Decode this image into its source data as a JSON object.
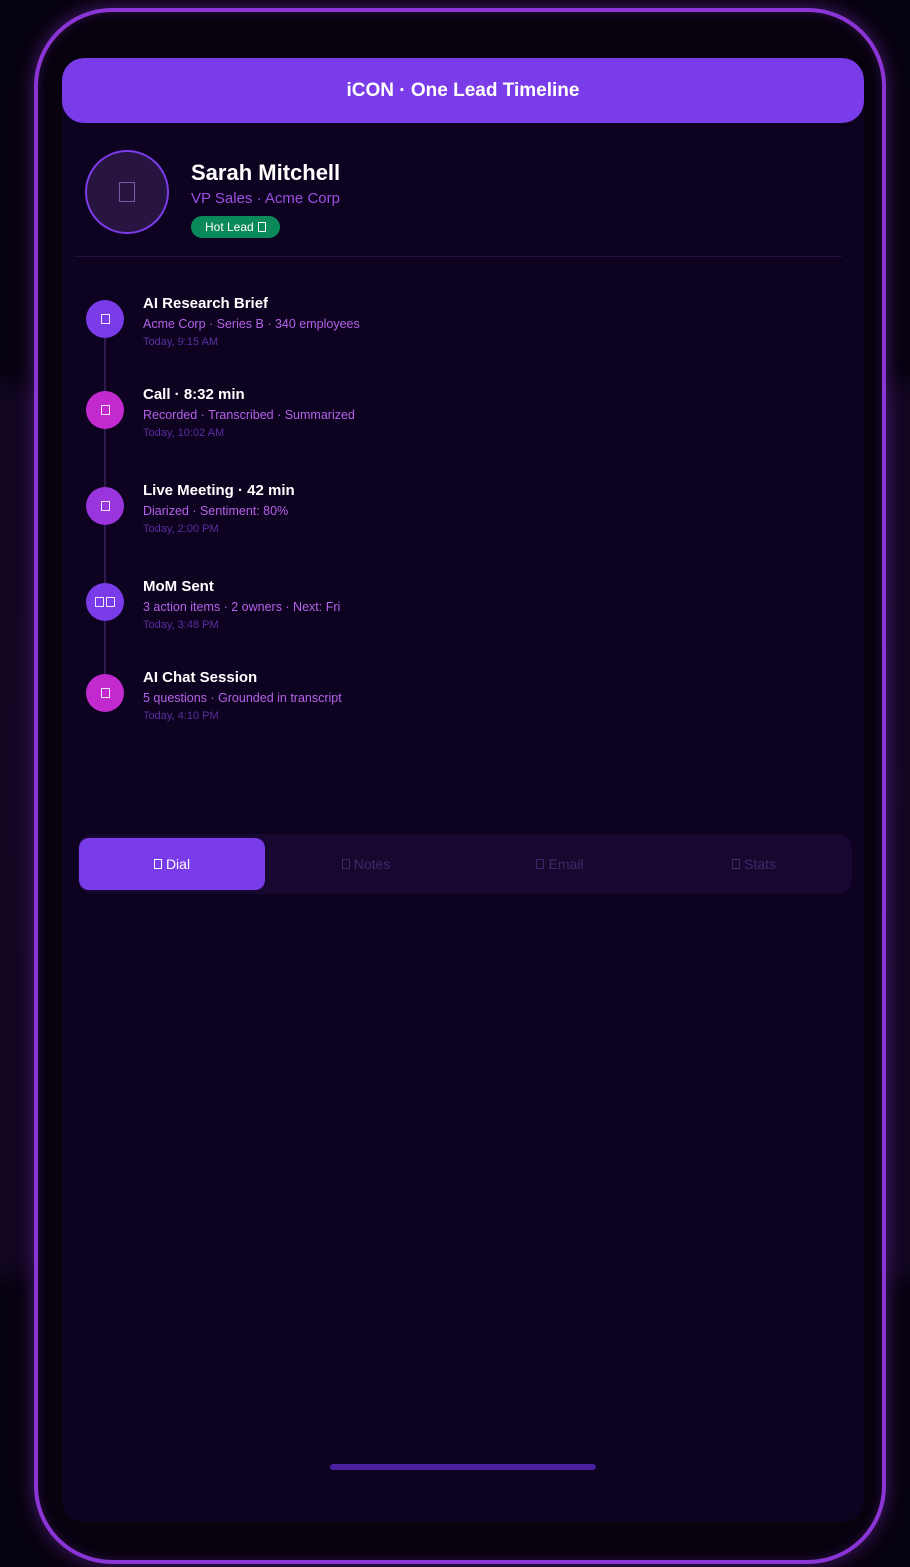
{
  "header": {
    "title": "iCON · One Lead Timeline"
  },
  "profile": {
    "name": "Sarah Mitchell",
    "title": "VP Sales · Acme Corp",
    "badge": "Hot Lead",
    "avatar_icon": "user-icon"
  },
  "timeline": [
    {
      "title": "AI Research Brief",
      "desc": "Acme Corp · Series B · 340 employees",
      "time": "Today, 9:15 AM",
      "icon": "research-icon",
      "color": "#7a3be8"
    },
    {
      "title": "Call · 8:32 min",
      "desc": "Recorded · Transcribed · Summarized",
      "time": "Today, 10:02 AM",
      "icon": "phone-icon",
      "color": "#c22ad0"
    },
    {
      "title": "Live Meeting · 42 min",
      "desc": "Diarized · Sentiment: 80%",
      "time": "Today, 2:00 PM",
      "icon": "meeting-icon",
      "color": "#9a34dc"
    },
    {
      "title": "MoM Sent",
      "desc": "3 action items · 2 owners · Next: Fri",
      "time": "Today, 3:48 PM",
      "icon": "document-icon",
      "color": "#7a3be8"
    },
    {
      "title": "AI Chat Session",
      "desc": "5 questions · Grounded in transcript",
      "time": "Today, 4:10 PM",
      "icon": "chat-icon",
      "color": "#c22ad0"
    }
  ],
  "nav": {
    "tabs": [
      {
        "label": "Dial",
        "icon": "dial-icon",
        "active": true
      },
      {
        "label": "Notes",
        "icon": "notes-icon",
        "active": false
      },
      {
        "label": "Email",
        "icon": "email-icon",
        "active": false
      },
      {
        "label": "Stats",
        "icon": "stats-icon",
        "active": false
      }
    ]
  },
  "colors": {
    "accent": "#7a3be8",
    "magenta": "#c22ad0",
    "hot_badge": "#0a8a5a",
    "background": "#0d0220"
  }
}
